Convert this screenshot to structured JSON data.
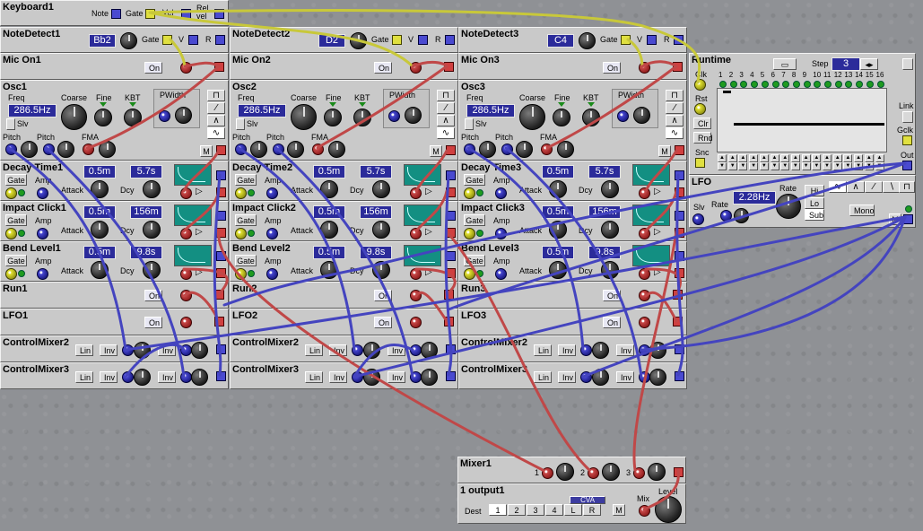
{
  "keyboard": {
    "title": "Keyboard1",
    "note": "Note",
    "gate": "Gate",
    "vel": "Vel",
    "relvel": "Rel\nvel"
  },
  "columns": [
    {
      "notedetect": {
        "title": "NoteDetect1",
        "note": "Bb2",
        "gate": "Gate",
        "v": "V",
        "r": "R"
      },
      "mic": {
        "title": "Mic On1",
        "btn": "On"
      },
      "osc": {
        "title": "Osc1",
        "freq_label": "Freq",
        "freq": "286.5Hz",
        "coarse": "Coarse",
        "fine": "Fine",
        "kbt": "KBT",
        "pwidth": "PWidth",
        "slv": "Slv",
        "pitch1": "Pitch",
        "pitch2": "Pitch",
        "fma": "FMA",
        "m": "M"
      },
      "env1": {
        "title": "Decay Time1",
        "attack": "0.5m",
        "decay": "5.7s",
        "gate": "Gate",
        "amp": "Amp",
        "attack_lbl": "Attack",
        "dcy_lbl": "Dcy"
      },
      "env2": {
        "title": "Impact Click1",
        "attack": "0.5m",
        "decay": "156m",
        "gate": "Gate",
        "amp": "Amp",
        "attack_lbl": "Attack",
        "dcy_lbl": "Dcy"
      },
      "env3": {
        "title": "Bend Level1",
        "attack": "0.5m",
        "decay": "9.8s",
        "gate": "Gate",
        "amp": "Amp",
        "attack_lbl": "Attack",
        "dcy_lbl": "Dcy"
      },
      "run": {
        "title": "Run1",
        "btn": "On"
      },
      "lfo": {
        "title": "LFO1",
        "btn": "On"
      },
      "cm2": {
        "title": "ControlMixer2",
        "lin": "Lin",
        "inv1": "Inv",
        "inv2": "Inv"
      },
      "cm3": {
        "title": "ControlMixer3",
        "lin": "Lin",
        "inv1": "Inv",
        "inv2": "Inv"
      }
    },
    {
      "notedetect": {
        "title": "NoteDetect2",
        "note": "D2",
        "gate": "Gate",
        "v": "V",
        "r": "R"
      },
      "mic": {
        "title": "Mic On2",
        "btn": "On"
      },
      "osc": {
        "title": "Osc2",
        "freq_label": "Freq",
        "freq": "286.5Hz",
        "coarse": "Coarse",
        "fine": "Fine",
        "kbt": "KBT",
        "pwidth": "PWidth",
        "slv": "Slv",
        "pitch1": "Pitch",
        "pitch2": "Pitch",
        "fma": "FMA",
        "m": "M"
      },
      "env1": {
        "title": "Decay Time2",
        "attack": "0.5m",
        "decay": "5.7s",
        "gate": "Gate",
        "amp": "Amp",
        "attack_lbl": "Attack",
        "dcy_lbl": "Dcy"
      },
      "env2": {
        "title": "Impact Click2",
        "attack": "0.5m",
        "decay": "156m",
        "gate": "Gate",
        "amp": "Amp",
        "attack_lbl": "Attack",
        "dcy_lbl": "Dcy"
      },
      "env3": {
        "title": "Bend Level2",
        "attack": "0.5m",
        "decay": "9.8s",
        "gate": "Gate",
        "amp": "Amp",
        "attack_lbl": "Attack",
        "dcy_lbl": "Dcy"
      },
      "run": {
        "title": "Run2",
        "btn": "On"
      },
      "lfo": {
        "title": "LFO2",
        "btn": "On"
      },
      "cm2": {
        "title": "ControlMixer2",
        "lin": "Lin",
        "inv1": "Inv",
        "inv2": "Inv"
      },
      "cm3": {
        "title": "ControlMixer3",
        "lin": "Lin",
        "inv1": "Inv",
        "inv2": "Inv"
      }
    },
    {
      "notedetect": {
        "title": "NoteDetect3",
        "note": "C4",
        "gate": "Gate",
        "v": "V",
        "r": "R"
      },
      "mic": {
        "title": "Mic On3",
        "btn": "On"
      },
      "osc": {
        "title": "Osc3",
        "freq_label": "Freq",
        "freq": "286.5Hz",
        "coarse": "Coarse",
        "fine": "Fine",
        "kbt": "KBT",
        "pwidth": "PWidth",
        "slv": "Slv",
        "pitch1": "Pitch",
        "pitch2": "Pitch",
        "fma": "FMA",
        "m": "M"
      },
      "env1": {
        "title": "Decay Time3",
        "attack": "0.5m",
        "decay": "5.7s",
        "gate": "Gate",
        "amp": "Amp",
        "attack_lbl": "Attack",
        "dcy_lbl": "Dcy"
      },
      "env2": {
        "title": "Impact Click3",
        "attack": "0.5m",
        "decay": "156m",
        "gate": "Gate",
        "amp": "Amp",
        "attack_lbl": "Attack",
        "dcy_lbl": "Dcy"
      },
      "env3": {
        "title": "Bend Level3",
        "attack": "0.5m",
        "decay": "9.8s",
        "gate": "Gate",
        "amp": "Amp",
        "attack_lbl": "Attack",
        "dcy_lbl": "Dcy"
      },
      "run": {
        "title": "Run3",
        "btn": "On"
      },
      "lfo": {
        "title": "LFO3",
        "btn": "On"
      },
      "cm2": {
        "title": "ControlMixer2",
        "lin": "Lin",
        "inv1": "Inv",
        "inv2": "Inv"
      },
      "cm3": {
        "title": "ControlMixer3",
        "lin": "Lin",
        "inv1": "Inv",
        "inv2": "Inv"
      }
    }
  ],
  "runtime": {
    "title": "Runtime",
    "step_label": "Step",
    "step": "3",
    "clk": "Clk",
    "rst": "Rst",
    "clr": "Clr",
    "rnd": "Rnd",
    "snc": "Snc",
    "link": "Link",
    "gclk": "Gclk",
    "out": "Out",
    "steps": [
      "1",
      "2",
      "3",
      "4",
      "5",
      "6",
      "7",
      "8",
      "9",
      "10",
      "11",
      "12",
      "13",
      "14",
      "15",
      "16"
    ]
  },
  "lfo_main": {
    "title": "LFO",
    "rate_display": "2.28Hz",
    "rate": "Rate",
    "rate2": "Rate",
    "slv": "Slv",
    "hi": "Hi",
    "lo": "Lo",
    "sub": "Sub",
    "mono": "Mono",
    "m": "M"
  },
  "mixer": {
    "title": "Mixer1",
    "in1": "1",
    "in2": "2",
    "in3": "3"
  },
  "output": {
    "title": "1 output1",
    "dest": "Dest",
    "dests": [
      "1",
      "2",
      "3",
      "4",
      "L",
      "R"
    ],
    "cva": "CVA",
    "m": "M",
    "mix": "Mix",
    "level": "Level"
  }
}
